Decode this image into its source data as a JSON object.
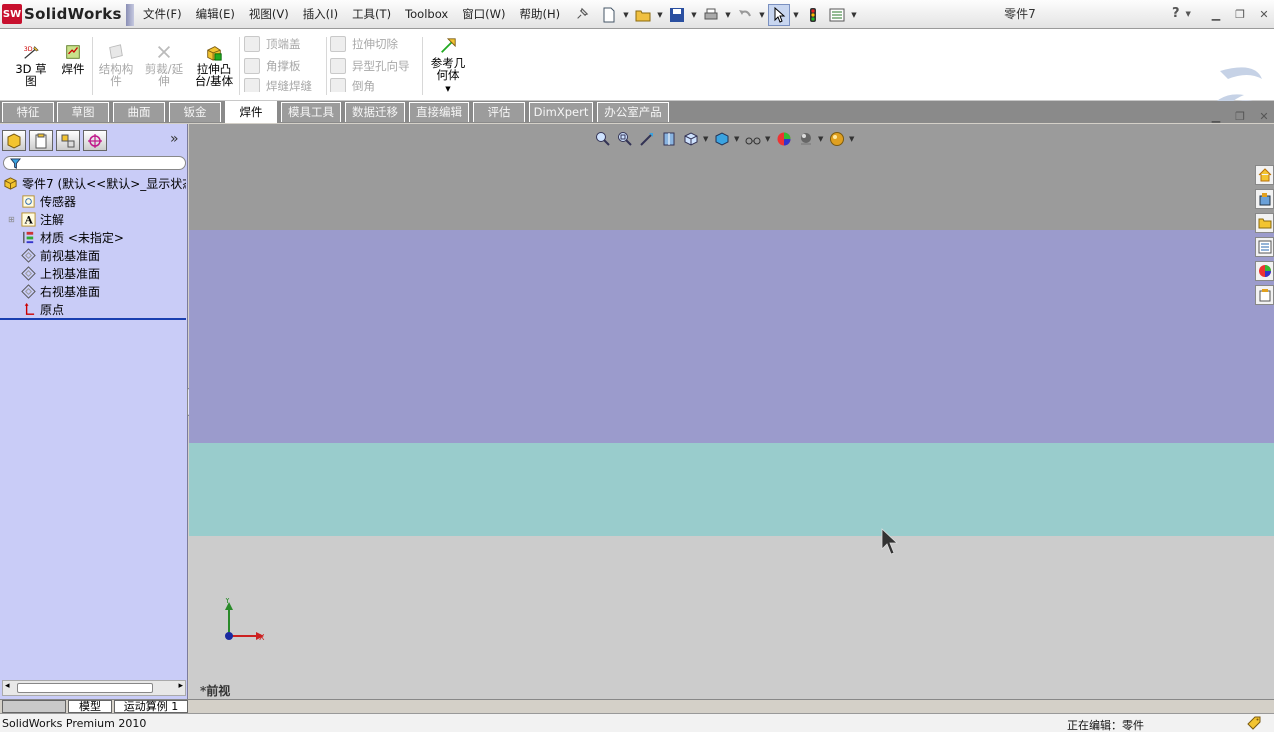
{
  "titlebar": {
    "app_name": "SolidWorks",
    "document_title": "零件7",
    "menu": [
      "文件(F)",
      "编辑(E)",
      "视图(V)",
      "插入(I)",
      "工具(T)",
      "Toolbox",
      "窗口(W)",
      "帮助(H)"
    ],
    "help_label": "?"
  },
  "command_manager": {
    "sketch3d": "3D 草图",
    "weldment": "焊件",
    "structural_member": "结构构件",
    "trim_extend": "剪裁/延伸",
    "extruded_boss": "拉伸凸台/基体",
    "end_cap": "顶端盖",
    "gusset": "角撑板",
    "weld_bead": "焊缝焊缝",
    "extruded_cut": "拉伸切除",
    "hole_wizard": "异型孔向导",
    "chamfer": "倒角",
    "ref_geometry": "参考几何体"
  },
  "tabs": [
    "特征",
    "草图",
    "曲面",
    "钣金",
    "焊件",
    "模具工具",
    "数据迁移",
    "直接编辑",
    "评估",
    "DimXpert",
    "办公室产品"
  ],
  "active_tab": "焊件",
  "feature_tree": {
    "root": "零件7 (默认<<默认>_显示状态",
    "items": [
      "传感器",
      "注解",
      "材质 <未指定>",
      "前视基准面",
      "上视基准面",
      "右视基准面",
      "原点"
    ]
  },
  "viewport": {
    "view_name": "*前视",
    "axis_x": "X",
    "axis_y": "Y"
  },
  "bottom_tabs": {
    "model": "模型",
    "motion": "运动算例 1"
  },
  "status": {
    "product": "SolidWorks Premium 2010",
    "editing": "正在编辑：零件"
  },
  "colors": {
    "background_top": "#9b9b9b",
    "background_band2": "#9b9bcc",
    "background_band3": "#99cccc",
    "background_bottom": "#cccccc",
    "tree_panel": "#c9ccf7"
  }
}
